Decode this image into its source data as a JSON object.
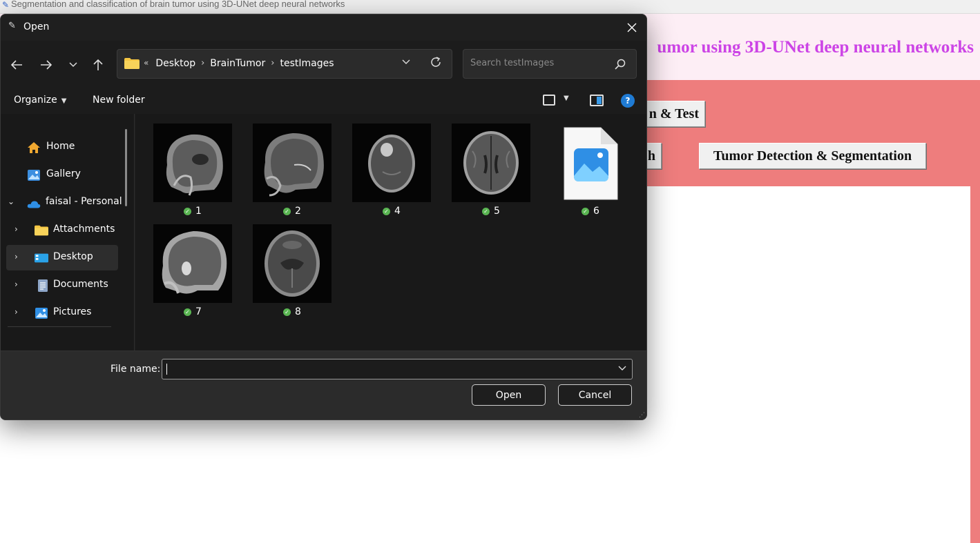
{
  "app": {
    "title": "Segmentation and classification of brain tumor using 3D-UNet deep neural networks",
    "heading": "umor using 3D-UNet deep neural networks",
    "buttons": {
      "train_test": "n & Test",
      "graph": "h",
      "tumor_detection": "Tumor Detection & Segmentation"
    },
    "colors": {
      "header_bg": "#fdeef5",
      "heading": "#cc44e6",
      "panel_bg": "#ee7d7d"
    }
  },
  "dialog": {
    "title": "Open",
    "nav": {
      "back_icon": "arrow-left-icon",
      "forward_icon": "arrow-right-icon",
      "recent_icon": "chevron-down-icon",
      "up_icon": "arrow-up-icon"
    },
    "address": {
      "overflow": "«",
      "crumbs": [
        "Desktop",
        "BrainTumor",
        "testImages"
      ]
    },
    "search": {
      "placeholder": "Search testImages"
    },
    "toolbar": {
      "organize": "Organize",
      "new_folder": "New folder",
      "help": "?"
    },
    "sidebar": {
      "items": [
        {
          "label": "Home",
          "icon": "home-icon",
          "expandable": false
        },
        {
          "label": "Gallery",
          "icon": "gallery-icon",
          "expandable": false
        },
        {
          "label": "faisal - Personal",
          "icon": "onedrive-icon",
          "expandable": true,
          "expanded": true
        },
        {
          "label": "Attachments",
          "icon": "folder-icon",
          "expandable": true
        },
        {
          "label": "Desktop",
          "icon": "desktop-icon",
          "expandable": true,
          "selected": true
        },
        {
          "label": "Documents",
          "icon": "documents-icon",
          "expandable": true
        },
        {
          "label": "Pictures",
          "icon": "pictures-icon",
          "expandable": true
        }
      ]
    },
    "files": [
      {
        "name": "1",
        "kind": "mri-sagittal"
      },
      {
        "name": "2",
        "kind": "mri-sagittal"
      },
      {
        "name": "4",
        "kind": "mri-axial"
      },
      {
        "name": "5",
        "kind": "mri-axial"
      },
      {
        "name": "6",
        "kind": "image-file-icon"
      },
      {
        "name": "7",
        "kind": "mri-sagittal"
      },
      {
        "name": "8",
        "kind": "mri-axial"
      }
    ],
    "footer": {
      "file_name_label": "File name:",
      "file_name_value": "",
      "open": "Open",
      "cancel": "Cancel"
    }
  }
}
